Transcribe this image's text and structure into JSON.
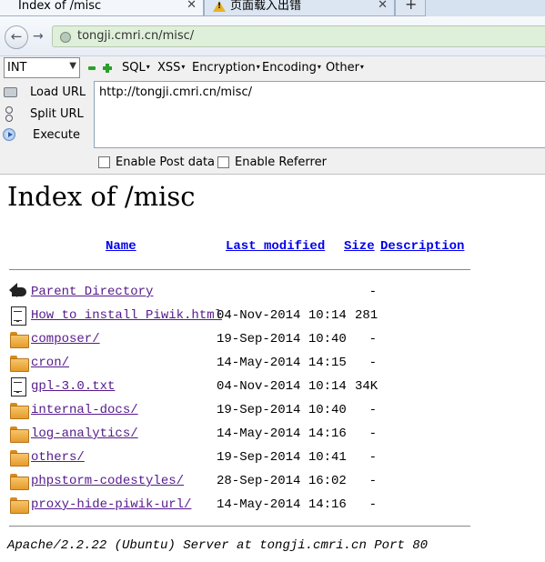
{
  "browser": {
    "tabs": [
      {
        "title": "Index of /misc",
        "active": true
      },
      {
        "title": "页面载入出错",
        "active": false
      }
    ],
    "new_tab_symbol": "+",
    "close_symbol": "✕",
    "url_display": "tongji.cmri.cn/misc/",
    "back_symbol": "←",
    "forward_symbol": "→",
    "url_bar_color": "#dff0da"
  },
  "hackbar": {
    "select_value": "INT",
    "select_arrow": "▼",
    "menus": [
      "SQL",
      "XSS",
      "Encryption",
      "Encoding",
      "Other"
    ],
    "caret": "▾",
    "actions": {
      "load": "Load URL",
      "split": "Split URL",
      "execute": "Execute"
    },
    "url_value": "http://tongji.cmri.cn/misc/",
    "checkboxes": {
      "post": "Enable Post data",
      "referrer": "Enable Referrer"
    }
  },
  "page": {
    "title": "Index of /misc",
    "columns": {
      "name": "Name",
      "modified": "Last modified",
      "size": "Size",
      "description": "Description"
    },
    "entries": [
      {
        "icon": "back-icon",
        "name": "Parent Directory",
        "date": "",
        "size": "-"
      },
      {
        "icon": "file-icon",
        "name": "How to install Piwik.html",
        "date": "04-Nov-2014 10:14",
        "size": "281"
      },
      {
        "icon": "folder-icon",
        "name": "composer/",
        "date": "19-Sep-2014 10:40",
        "size": "-"
      },
      {
        "icon": "folder-icon",
        "name": "cron/",
        "date": "14-May-2014 14:15",
        "size": "-"
      },
      {
        "icon": "file-icon",
        "name": "gpl-3.0.txt",
        "date": "04-Nov-2014 10:14",
        "size": "34K"
      },
      {
        "icon": "folder-icon",
        "name": "internal-docs/",
        "date": "19-Sep-2014 10:40",
        "size": "-"
      },
      {
        "icon": "folder-icon",
        "name": "log-analytics/",
        "date": "14-May-2014 14:16",
        "size": "-"
      },
      {
        "icon": "folder-icon",
        "name": "others/",
        "date": "19-Sep-2014 10:41",
        "size": "-"
      },
      {
        "icon": "folder-icon",
        "name": "phpstorm-codestyles/",
        "date": "28-Sep-2014 16:02",
        "size": "-"
      },
      {
        "icon": "folder-icon",
        "name": "proxy-hide-piwik-url/",
        "date": "14-May-2014 14:16",
        "size": "-"
      }
    ],
    "address": "Apache/2.2.22 (Ubuntu) Server at tongji.cmri.cn Port 80",
    "link_color": "#0000ee",
    "visited_color": "#551a8b"
  }
}
